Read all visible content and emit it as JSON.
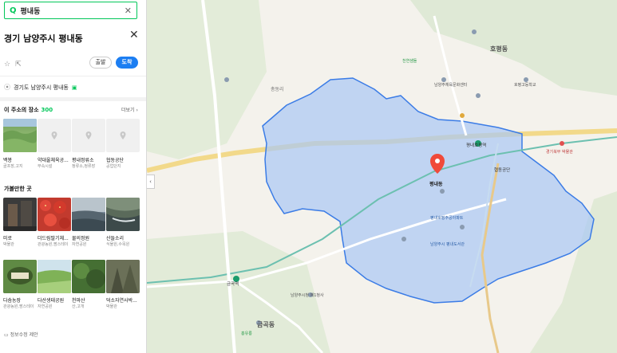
{
  "search": {
    "query": "평내동"
  },
  "place": {
    "title": "경기 남양주시 평내동",
    "origin_label": "출발",
    "dest_label": "도착",
    "address": "경기도 남양주시 평내동"
  },
  "nearby": {
    "heading": "이 주소의 장소",
    "count": "300",
    "more": "더보기 ›",
    "items": [
      {
        "name": "백봉",
        "sub": "골프장,고지"
      },
      {
        "name": "약대울체육공...",
        "sub": "부속시설"
      },
      {
        "name": "평내정류소",
        "sub": "정류소,정류장"
      },
      {
        "name": "협동공단",
        "sub": "공업단지"
      }
    ]
  },
  "recommend": {
    "heading": "가볼만한 곳",
    "items": [
      {
        "name": "미로",
        "sub": "박물관"
      },
      {
        "name": "더드림딸기체...",
        "sub": "관광농원,팜스테이"
      },
      {
        "name": "물의정원",
        "sub": "자연공원"
      },
      {
        "name": "산들소리",
        "sub": "식물원,수목원"
      },
      {
        "name": "다솜농장",
        "sub": "관광농원,팜스테이"
      },
      {
        "name": "다산생태공원",
        "sub": "자연공원"
      },
      {
        "name": "천마산",
        "sub": "산,고개"
      },
      {
        "name": "덕소자연사박...",
        "sub": "박물관"
      }
    ]
  },
  "report": "정보수정 제안",
  "map": {
    "area_fill": "#a9c8f5",
    "area_stroke": "#3b7ce6",
    "marker_color": "#f04a3a",
    "marker_label": "평내동",
    "labels": {
      "hopyeong": "호평동",
      "geumgok": "금곡동",
      "chonggokri": "총동리",
      "pyeongnae_station": "평내호평역",
      "geumgok_station": "금곡역",
      "hyeopdong": "협동공단",
      "bukhan_gym": "남양주체육문화센터",
      "hopyeong_school": "호평고등학교",
      "naengjang": "천연샘돌",
      "pyeongnae_apt": "평내호평주공아파트",
      "office": "남양주시청 제1청사",
      "library": "남양주시 평내도서관",
      "culture": "경기북부 박물관",
      "geumgok_park": "홍유릉",
      "station_mid": "평내동"
    }
  }
}
